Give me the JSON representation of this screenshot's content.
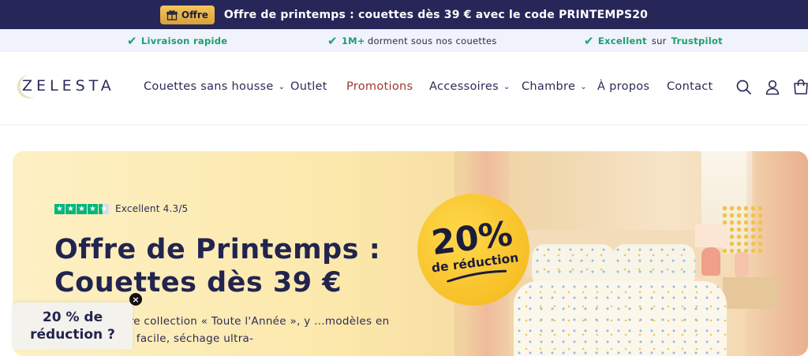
{
  "announcement": {
    "pill_label": "Offre",
    "pill_icon": "gift-icon",
    "text": "Offre de printemps : couettes dès 39 € avec le code PRINTEMPS20"
  },
  "usp": [
    {
      "icon": "check-icon",
      "bold": "Livraison rapide",
      "text": ""
    },
    {
      "icon": "check-icon",
      "bold": "1M+",
      "text": " dorment sous nos couettes"
    },
    {
      "icon": "check-icon",
      "bold": "Excellent",
      "text": " sur ",
      "bold2": "Trustpilot"
    }
  ],
  "logo": {
    "text": "ZELESTA"
  },
  "nav": {
    "items": [
      {
        "label": "Couettes sans housse",
        "has_dropdown": true
      },
      {
        "label": "Outlet",
        "has_dropdown": false
      },
      {
        "label": "Promotions",
        "has_dropdown": false
      },
      {
        "label": "Accessoires",
        "has_dropdown": true
      },
      {
        "label": "Chambre",
        "has_dropdown": true
      },
      {
        "label": "À propos",
        "has_dropdown": false
      },
      {
        "label": "Contact",
        "has_dropdown": false
      }
    ],
    "icons": [
      "search-icon",
      "account-icon",
      "cart-icon"
    ]
  },
  "hero": {
    "rating_text": "Excellent 4.3/5",
    "rating_value": 4.3,
    "title_line1": "Offre de Printemps :",
    "title_line2": "Couettes dès 39 €",
    "description": "…0 % sur notre collection « Toute l'Année », y …modèles en coton. Lavage facile, séchage ultra-",
    "badge_big": "20%",
    "badge_small": "de réduction"
  },
  "popup": {
    "text_line1": "20 % de",
    "text_line2": "réduction ?",
    "close_label": "×"
  },
  "colors": {
    "navy": "#262659",
    "green": "#1f9e6e",
    "promo_red": "#a0372f",
    "badge_yellow": "#f4b619",
    "trustpilot_green": "#00b67a"
  }
}
